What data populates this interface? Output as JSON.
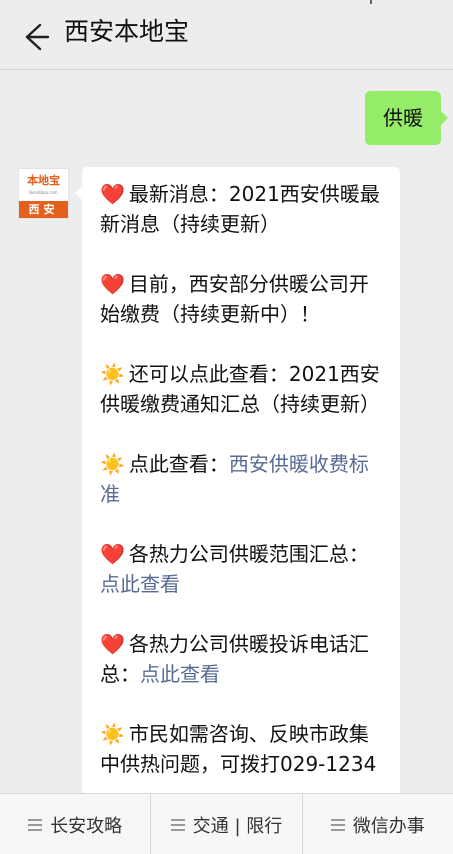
{
  "header": {
    "title": "西安本地宝"
  },
  "chat": {
    "user_message": "供暖",
    "avatar": {
      "logo_text": "本地宝",
      "logo_sub": "Bendibao.com",
      "city": "西安"
    },
    "bot_paragraphs": [
      {
        "icon": "heart",
        "text": "最新消息：2021西安供暖最新消息（持续更新）",
        "link": ""
      },
      {
        "icon": "heart",
        "text": "目前，西安部分供暖公司开始缴费（持续更新中）！",
        "link": ""
      },
      {
        "icon": "sun",
        "text": "还可以点此查看：2021西安供暖缴费通知汇总（持续更新）",
        "link": ""
      },
      {
        "icon": "sun",
        "text": "点此查看：",
        "link": "西安供暖收费标准"
      },
      {
        "icon": "heart",
        "text": "各热力公司供暖范围汇总：",
        "link": "点此查看"
      },
      {
        "icon": "heart",
        "text": "各热力公司供暖投诉电话汇总：",
        "link": "点此查看"
      },
      {
        "icon": "sun",
        "text": "市民如需咨询、反映市政集中供热问题，可拨打029-1234",
        "link": ""
      }
    ]
  },
  "icons": {
    "heart": "❤️",
    "sun": "☀️"
  },
  "menu": {
    "items": [
      "长安攻略",
      "交通 | 限行",
      "微信办事"
    ]
  }
}
